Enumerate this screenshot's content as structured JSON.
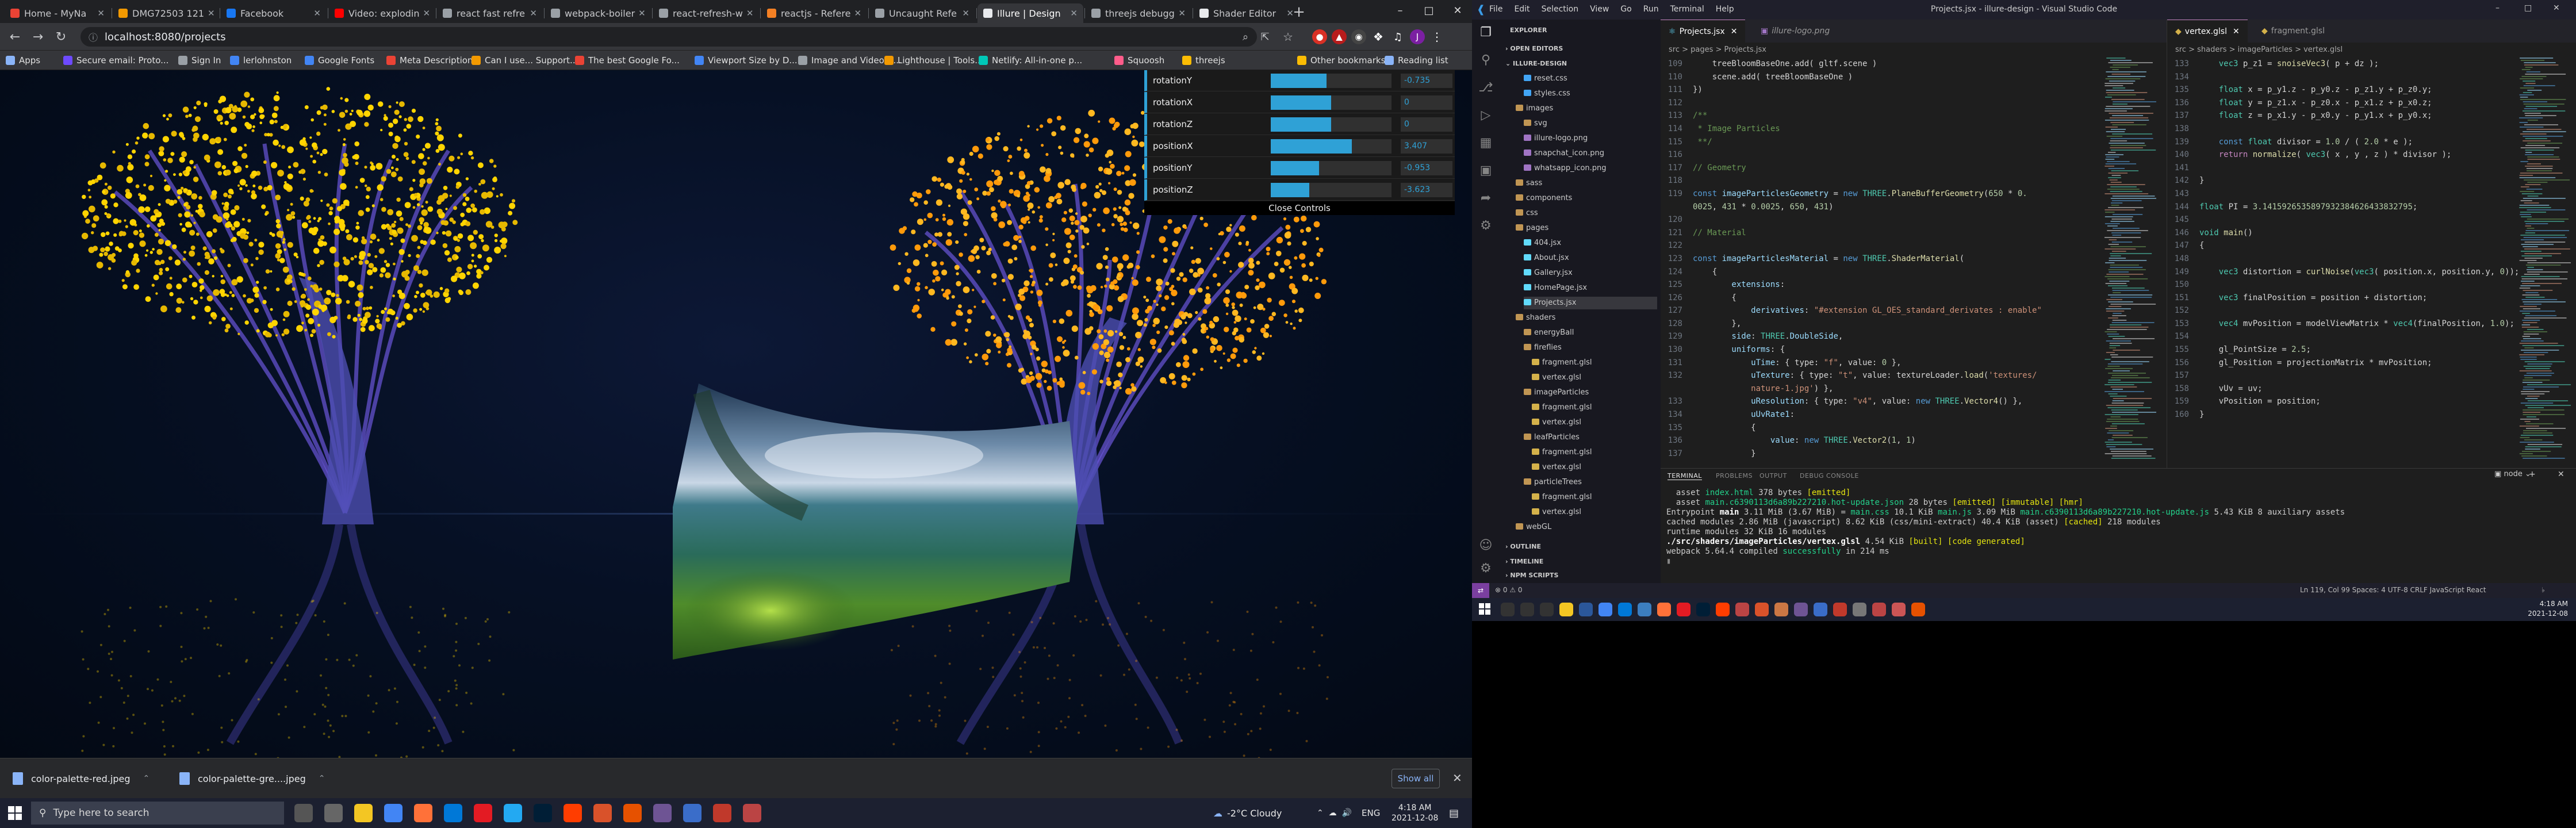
{
  "browser": {
    "tabs": [
      {
        "title": "Home - MyNa",
        "color": "#ea4335"
      },
      {
        "title": "DMG72503 121",
        "color": "#f29900"
      },
      {
        "title": "Facebook",
        "color": "#1877f2"
      },
      {
        "title": "Video: explodin",
        "color": "#ff0000"
      },
      {
        "title": "react fast refre",
        "color": "#9aa0a6"
      },
      {
        "title": "webpack-boiler",
        "color": "#9aa0a6"
      },
      {
        "title": "react-refresh-w",
        "color": "#9aa0a6"
      },
      {
        "title": "reactjs - Refere",
        "color": "#f48024"
      },
      {
        "title": "Uncaught Refe",
        "color": "#9aa0a6"
      },
      {
        "title": "Illure | Design",
        "color": "#e8eaed"
      },
      {
        "title": "threejs debugg",
        "color": "#9aa0a6"
      },
      {
        "title": "Shader Editor",
        "color": "#e8eaed"
      }
    ],
    "active_tab_index": 9,
    "url": "localhost:8080/projects",
    "bookmarks": [
      {
        "label": "Apps",
        "color": "#8ab4f8"
      },
      {
        "label": "Secure email: Proto...",
        "color": "#6d4aff"
      },
      {
        "label": "Sign In",
        "color": "#9aa0a6"
      },
      {
        "label": "lerlohnston",
        "color": "#4285f4"
      },
      {
        "label": "Google Fonts",
        "color": "#4285f4"
      },
      {
        "label": "Meta Description...",
        "color": "#ea4335"
      },
      {
        "label": "Can I use... Support...",
        "color": "#f29900"
      },
      {
        "label": "The best Google Fo...",
        "color": "#ea4335"
      },
      {
        "label": "Viewport Size by D...",
        "color": "#4285f4"
      },
      {
        "label": "Image and Video U...",
        "color": "#9aa0a6"
      },
      {
        "label": "Lighthouse | Tools...",
        "color": "#f29900"
      },
      {
        "label": "Netlify: All-in-one p...",
        "color": "#00c7b7"
      },
      {
        "label": "Squoosh",
        "color": "#ff5c8a"
      },
      {
        "label": "threejs",
        "color": "#fbbc04"
      }
    ],
    "other_bookmarks": "Other bookmarks",
    "reading_list": "Reading list"
  },
  "gui": {
    "rows": [
      {
        "label": "rotationY",
        "value": "-0.735",
        "fill": 0.46
      },
      {
        "label": "rotationX",
        "value": "0",
        "fill": 0.5
      },
      {
        "label": "rotationZ",
        "value": "0",
        "fill": 0.5
      },
      {
        "label": "positionX",
        "value": "3.407",
        "fill": 0.67
      },
      {
        "label": "positionY",
        "value": "-0.953",
        "fill": 0.4
      },
      {
        "label": "positionZ",
        "value": "-3.623",
        "fill": 0.32
      }
    ],
    "close": "Close Controls"
  },
  "downloads": {
    "items": [
      "color-palette-red.jpeg",
      "color-palette-gre....jpeg"
    ],
    "show_all": "Show all"
  },
  "taskbar_left": {
    "search_placeholder": "Type here to search",
    "weather": "-2°C  Cloudy",
    "lang": "ENG",
    "time": "4:18 AM",
    "date": "2021-12-08"
  },
  "vscode": {
    "menu": [
      "File",
      "Edit",
      "Selection",
      "View",
      "Go",
      "Run",
      "Terminal",
      "Help"
    ],
    "window_title": "Projects.jsx - illure-design - Visual Studio Code",
    "explorer_title": "EXPLORER",
    "open_editors": "OPEN EDITORS",
    "project": "ILLURE-DESIGN",
    "tree": [
      {
        "name": "reset.css",
        "indent": 2,
        "type": "css"
      },
      {
        "name": "styles.css",
        "indent": 2,
        "type": "css"
      },
      {
        "name": "images",
        "indent": 1,
        "type": "folder"
      },
      {
        "name": "svg",
        "indent": 2,
        "type": "folder"
      },
      {
        "name": "illure-logo.png",
        "indent": 2,
        "type": "img"
      },
      {
        "name": "snapchat_icon.png",
        "indent": 2,
        "type": "img"
      },
      {
        "name": "whatsapp_icon.png",
        "indent": 2,
        "type": "img"
      },
      {
        "name": "sass",
        "indent": 1,
        "type": "folder"
      },
      {
        "name": "components",
        "indent": 1,
        "type": "folder"
      },
      {
        "name": "css",
        "indent": 1,
        "type": "folder"
      },
      {
        "name": "pages",
        "indent": 1,
        "type": "folder"
      },
      {
        "name": "404.jsx",
        "indent": 2,
        "type": "jsx"
      },
      {
        "name": "About.jsx",
        "indent": 2,
        "type": "jsx"
      },
      {
        "name": "Gallery.jsx",
        "indent": 2,
        "type": "jsx"
      },
      {
        "name": "HomePage.jsx",
        "indent": 2,
        "type": "jsx"
      },
      {
        "name": "Projects.jsx",
        "indent": 2,
        "type": "jsx"
      },
      {
        "name": "shaders",
        "indent": 1,
        "type": "folder"
      },
      {
        "name": "energyBall",
        "indent": 2,
        "type": "folder"
      },
      {
        "name": "fireflies",
        "indent": 2,
        "type": "folder"
      },
      {
        "name": "fragment.glsl",
        "indent": 3,
        "type": "glsl"
      },
      {
        "name": "vertex.glsl",
        "indent": 3,
        "type": "glsl"
      },
      {
        "name": "imageParticles",
        "indent": 2,
        "type": "folder"
      },
      {
        "name": "fragment.glsl",
        "indent": 3,
        "type": "glsl"
      },
      {
        "name": "vertex.glsl",
        "indent": 3,
        "type": "glsl"
      },
      {
        "name": "leafParticles",
        "indent": 2,
        "type": "folder"
      },
      {
        "name": "fragment.glsl",
        "indent": 3,
        "type": "glsl"
      },
      {
        "name": "vertex.glsl",
        "indent": 3,
        "type": "glsl"
      },
      {
        "name": "particleTrees",
        "indent": 2,
        "type": "folder"
      },
      {
        "name": "fragment.glsl",
        "indent": 3,
        "type": "glsl"
      },
      {
        "name": "vertex.glsl",
        "indent": 3,
        "type": "glsl"
      },
      {
        "name": "webGL",
        "indent": 1,
        "type": "folder"
      }
    ],
    "outline": "OUTLINE",
    "timeline": "TIMELINE",
    "npm": "NPM SCRIPTS",
    "editor1_tabs": [
      "Projects.jsx",
      "illure-logo.png"
    ],
    "editor1_bread": "src > pages > Projects.jsx",
    "editor2_tabs": [
      "vertex.glsl",
      "fragment.glsl"
    ],
    "editor2_bread": "src > shaders > imageParticles > vertex.glsl",
    "panel_tabs": [
      "TERMINAL",
      "PROBLEMS",
      "OUTPUT",
      "DEBUG CONSOLE"
    ],
    "terminal_shell": "node",
    "status_right": "Ln 119, Col 99   Spaces: 4   UTF-8   CRLF   JavaScript React",
    "status_left": "⊗ 0 ⚠ 0"
  },
  "taskbar_right": {
    "time": "4:18 AM",
    "date": "2021-12-08"
  }
}
